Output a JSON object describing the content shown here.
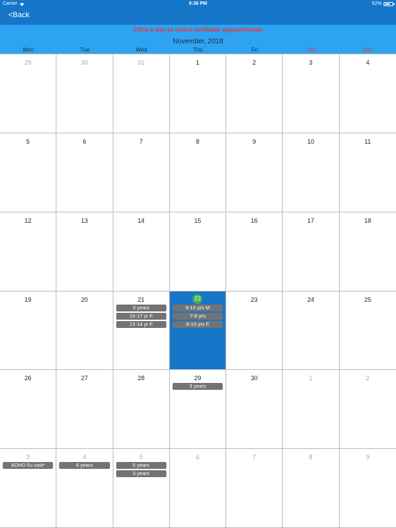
{
  "status_bar": {
    "carrier": "Carrier",
    "time": "9:36 PM",
    "battery": "62%"
  },
  "nav": {
    "back_label": "<Back"
  },
  "header": {
    "instruction": "Click a day to select available appointments",
    "month_title": "November, 2018"
  },
  "weekdays": [
    {
      "label": "Mon",
      "weekend": false
    },
    {
      "label": "Tue",
      "weekend": false
    },
    {
      "label": "Wed",
      "weekend": false
    },
    {
      "label": "Thu",
      "weekend": false
    },
    {
      "label": "Fri",
      "weekend": false
    },
    {
      "label": "Sat",
      "weekend": true
    },
    {
      "label": "Sun",
      "weekend": true
    }
  ],
  "colors": {
    "nav_blue": "#1576c8",
    "header_blue": "#2ea3f2",
    "weekend_red": "#e23b3b",
    "appointment_gray": "#737373",
    "today_green": "#4caf50"
  },
  "days": [
    {
      "num": "29",
      "other": true,
      "appts": []
    },
    {
      "num": "30",
      "other": true,
      "appts": []
    },
    {
      "num": "31",
      "other": true,
      "appts": []
    },
    {
      "num": "1",
      "other": false,
      "appts": []
    },
    {
      "num": "2",
      "other": false,
      "appts": []
    },
    {
      "num": "3",
      "other": false,
      "appts": []
    },
    {
      "num": "4",
      "other": false,
      "appts": []
    },
    {
      "num": "5",
      "other": false,
      "appts": []
    },
    {
      "num": "6",
      "other": false,
      "appts": []
    },
    {
      "num": "7",
      "other": false,
      "appts": []
    },
    {
      "num": "8",
      "other": false,
      "appts": []
    },
    {
      "num": "9",
      "other": false,
      "appts": []
    },
    {
      "num": "10",
      "other": false,
      "appts": []
    },
    {
      "num": "11",
      "other": false,
      "appts": []
    },
    {
      "num": "12",
      "other": false,
      "appts": []
    },
    {
      "num": "13",
      "other": false,
      "appts": []
    },
    {
      "num": "14",
      "other": false,
      "appts": []
    },
    {
      "num": "15",
      "other": false,
      "appts": []
    },
    {
      "num": "16",
      "other": false,
      "appts": []
    },
    {
      "num": "17",
      "other": false,
      "appts": []
    },
    {
      "num": "18",
      "other": false,
      "appts": []
    },
    {
      "num": "19",
      "other": false,
      "appts": []
    },
    {
      "num": "20",
      "other": false,
      "appts": []
    },
    {
      "num": "21",
      "other": false,
      "appts": [
        "3 years",
        "15-17 yr F",
        "13-14 yr F"
      ]
    },
    {
      "num": "22",
      "other": false,
      "selected": true,
      "appts": [
        "9-10 yrs M",
        "7-8 yrs",
        "9-10 yrs F"
      ]
    },
    {
      "num": "23",
      "other": false,
      "appts": []
    },
    {
      "num": "24",
      "other": false,
      "appts": []
    },
    {
      "num": "25",
      "other": false,
      "appts": []
    },
    {
      "num": "26",
      "other": false,
      "appts": []
    },
    {
      "num": "27",
      "other": false,
      "appts": []
    },
    {
      "num": "28",
      "other": false,
      "appts": []
    },
    {
      "num": "29",
      "other": false,
      "appts": [
        "3 years"
      ]
    },
    {
      "num": "30",
      "other": false,
      "appts": []
    },
    {
      "num": "1",
      "other": true,
      "appts": []
    },
    {
      "num": "2",
      "other": true,
      "appts": []
    },
    {
      "num": "3",
      "other": true,
      "appts": [
        "ADHD f/u visit*"
      ]
    },
    {
      "num": "4",
      "other": true,
      "appts": [
        "6 years"
      ]
    },
    {
      "num": "5",
      "other": true,
      "appts": [
        "5 years",
        "3 years"
      ]
    },
    {
      "num": "6",
      "other": true,
      "appts": []
    },
    {
      "num": "7",
      "other": true,
      "appts": []
    },
    {
      "num": "8",
      "other": true,
      "appts": []
    },
    {
      "num": "9",
      "other": true,
      "appts": []
    }
  ]
}
